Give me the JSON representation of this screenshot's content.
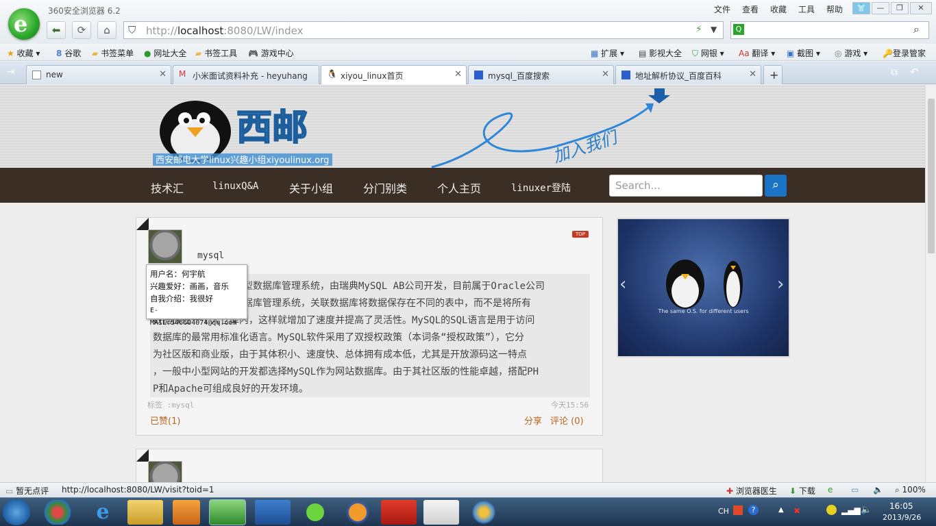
{
  "app": {
    "title": "360安全浏览器 6.2"
  },
  "menu": [
    "文件",
    "查看",
    "收藏",
    "工具",
    "帮助"
  ],
  "address": {
    "host": "http://",
    "domain": "localhost",
    "rest": ":8080/LW/index"
  },
  "bookmarks": [
    "收藏",
    "谷歌",
    "书签菜单",
    "网址大全",
    "书签工具",
    "游戏中心"
  ],
  "bookmarks_right": [
    "扩展",
    "影视大全",
    "网银",
    "翻译",
    "截图",
    "游戏",
    "登录管家"
  ],
  "tabs": [
    {
      "label": "new"
    },
    {
      "label": "小米面试资料补充 - heyuhang"
    },
    {
      "label": "xiyou_linux首页"
    },
    {
      "label": "mysql_百度搜索"
    },
    {
      "label": "地址解析协议_百度百科"
    }
  ],
  "site": {
    "logo_text": "西邮",
    "logo_sub": "西安邮电大学linux兴趣小组xiyoulinux.org",
    "join": "加入我们",
    "nav": [
      "技术汇",
      "linuxQ&A",
      "关于小组",
      "分门别类",
      "个人主页",
      "linuxer登陆"
    ],
    "search_placeholder": "Search..."
  },
  "post": {
    "title": "mysql",
    "top_badge": "TOP",
    "lines": [
      "系型数据库管理系统，由瑞典MySQL AB公司开发，目前属于Oracle公司",
      "数据库管理系统，关联数据库将数据保存在不同的表中，而不是将所有",
      "数据放在一个大仓库内，这样就增加了速度并提高了灵活性。MySQL的SQL语言是用于访问",
      "数据库的最常用标准化语言。MySQL软件采用了双授权政策（本词条“授权政策”），它分",
      "为社区版和商业版，由于其体积小、速度快、总体拥有成本低，尤其是开放源码这一特点",
      "，一般中小型网站的开发都选择MySQL作为网站数据库。由于其社区版的性能卓越，搭配PH",
      "P和Apache可组成良好的开发环境。"
    ],
    "tags": "标签 :mysql",
    "time": "今天15:56",
    "liked": "已赞(1)",
    "share": "分享",
    "comment": "评论 (0)"
  },
  "tooltip": [
    "用户名：何宇航",
    "兴趣爱好：画画，音乐",
    "自我介绍：我很好",
    "E-MAIL:546604074@qq.com"
  ],
  "carousel": {
    "caption": "The same O.S. for different users",
    "prev": "‹",
    "next": "›"
  },
  "status": {
    "left": "暂无点评",
    "url": "http://localhost:8080/LW/visit?toid=1",
    "doctor": "浏览器医生",
    "download": "下载",
    "zoom": "100%"
  },
  "tray": {
    "lang": "CH",
    "time": "16:05",
    "date": "2013/9/26"
  }
}
